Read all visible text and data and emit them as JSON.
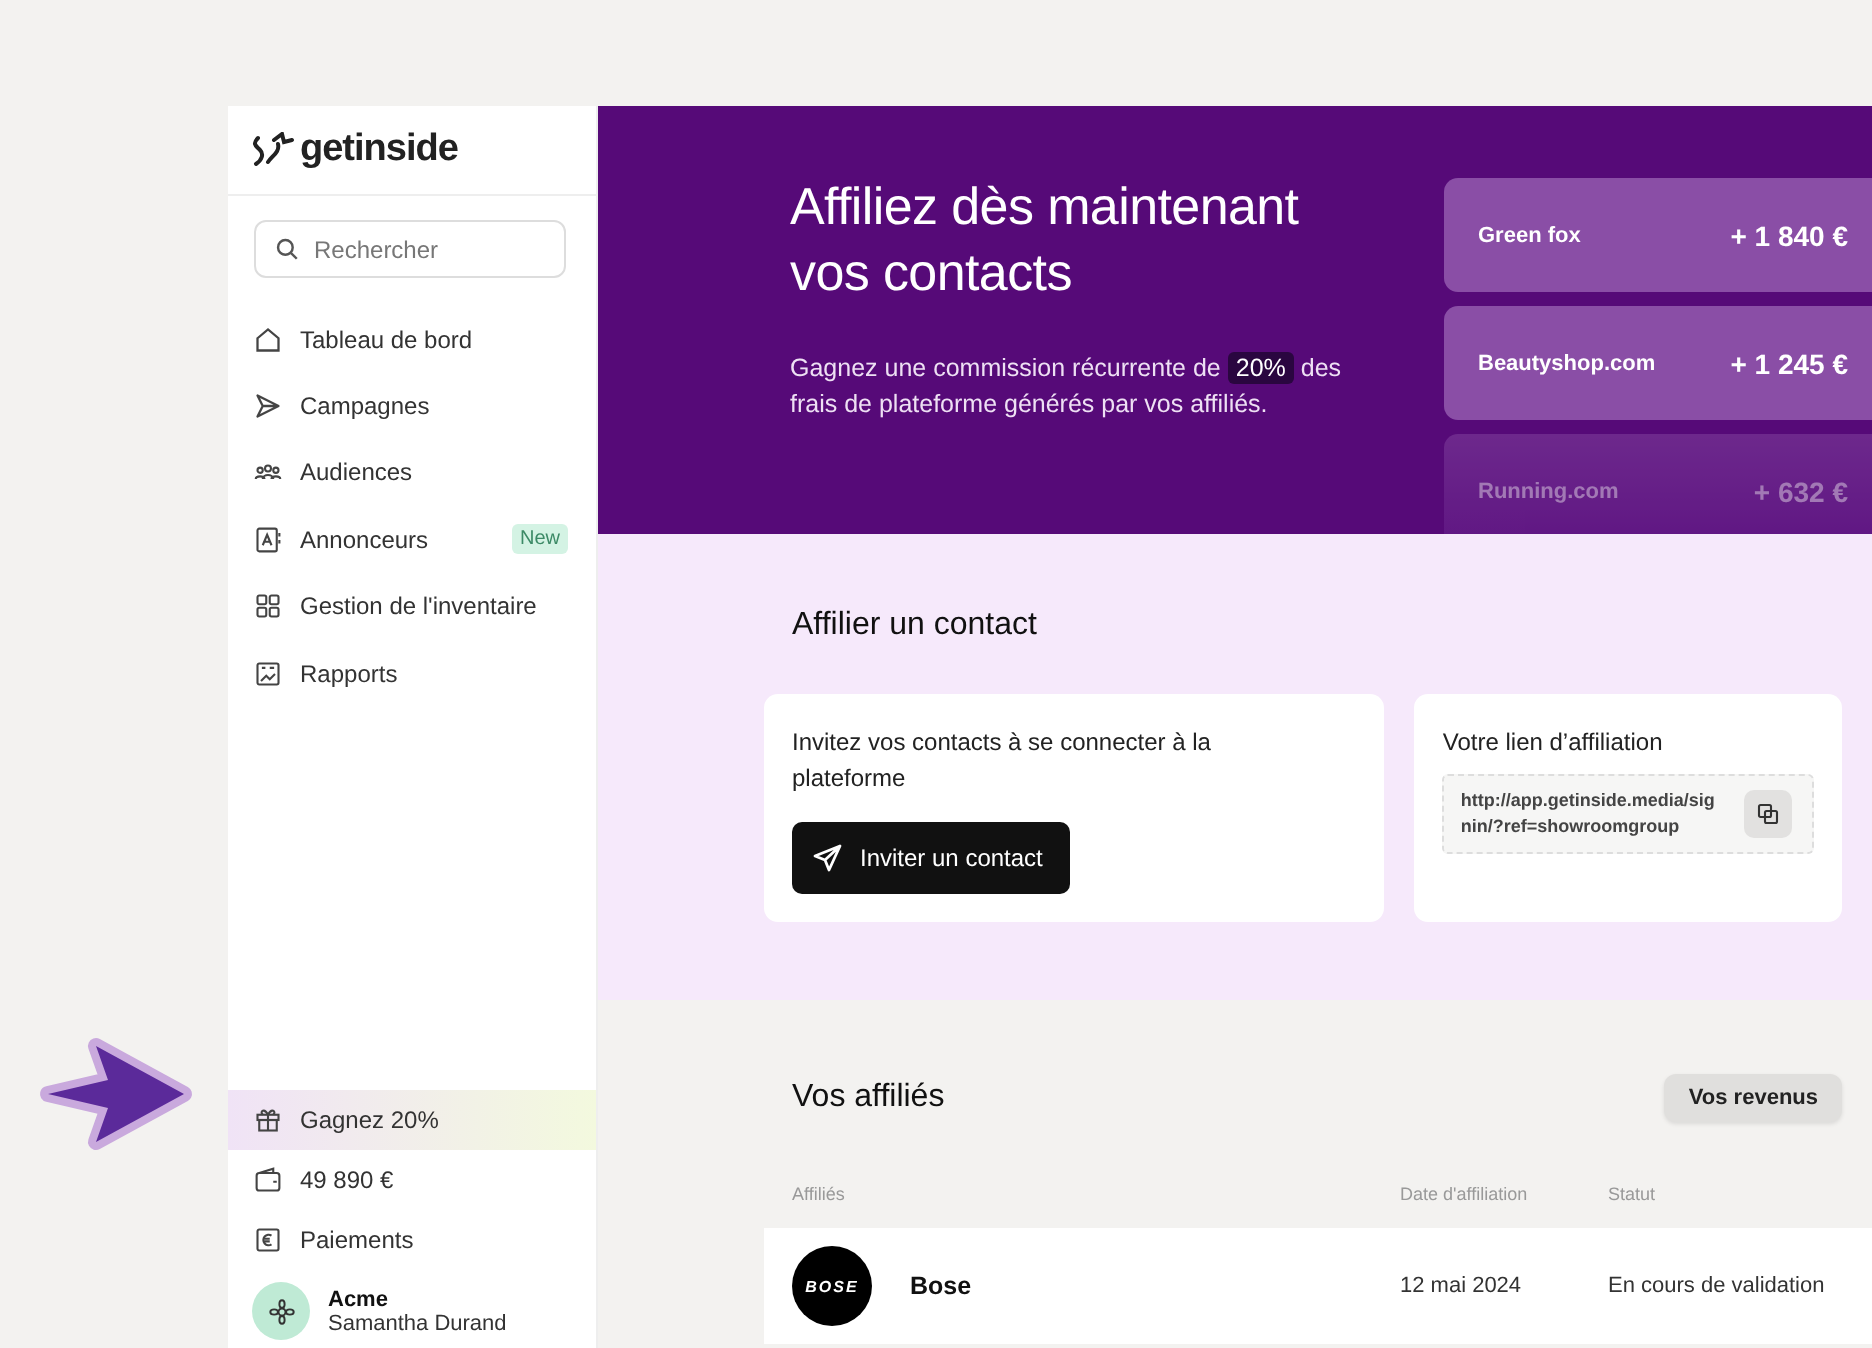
{
  "brand": {
    "name": "getinside"
  },
  "search": {
    "placeholder": "Rechercher"
  },
  "nav": [
    {
      "kind": "home",
      "label": "Tableau de bord",
      "selected": false
    },
    {
      "kind": "send",
      "label": "Campagnes",
      "selected": false
    },
    {
      "kind": "people",
      "label": "Audiences",
      "selected": false
    },
    {
      "kind": "contact",
      "label": "Annonceurs",
      "selected": false,
      "badge": "New"
    },
    {
      "kind": "grid",
      "label": "Gestion de l'inventaire",
      "selected": false
    },
    {
      "kind": "report",
      "label": "Rapports",
      "selected": false
    }
  ],
  "bottom_nav": [
    {
      "kind": "gift",
      "label": "Gagnez 20%",
      "selected": true
    },
    {
      "kind": "wallet",
      "label": "49 890 €",
      "selected": false
    },
    {
      "kind": "euro",
      "label": "Paiements",
      "selected": false
    }
  ],
  "user": {
    "company": "Acme",
    "name": "Samantha Durand"
  },
  "hero": {
    "title": "Affiliez dès maintenant vos contacts",
    "text_before": "Gagnez une commission récurrente de",
    "highlight": "20%",
    "text_after": "des frais de plateforme générés par vos affiliés.",
    "earnings": [
      {
        "name": "Green fox",
        "amount": "+ 1 840 €",
        "faded": false
      },
      {
        "name": "Beautyshop.com",
        "amount": "+ 1 245 €",
        "faded": false
      },
      {
        "name": "Running.com",
        "amount": "+ 632 €",
        "faded": true
      }
    ]
  },
  "affiliate_section": {
    "title": "Affilier un contact",
    "invite_text": "Invitez vos contacts à se connecter à la plateforme",
    "invite_button": "Inviter un contact",
    "link_title": "Votre lien d’affiliation",
    "link": "http://app.getinside.media/signin/?ref=showroomgroup"
  },
  "affiliates": {
    "title": "Vos affiliés",
    "revenue_button": "Vos revenus",
    "columns": [
      "Affiliés",
      "Date d'affiliation",
      "Statut"
    ],
    "rows": [
      {
        "logo_text": "BOSE",
        "name": "Bose",
        "date": "12 mai 2024",
        "status": "En cours de validation"
      }
    ]
  }
}
